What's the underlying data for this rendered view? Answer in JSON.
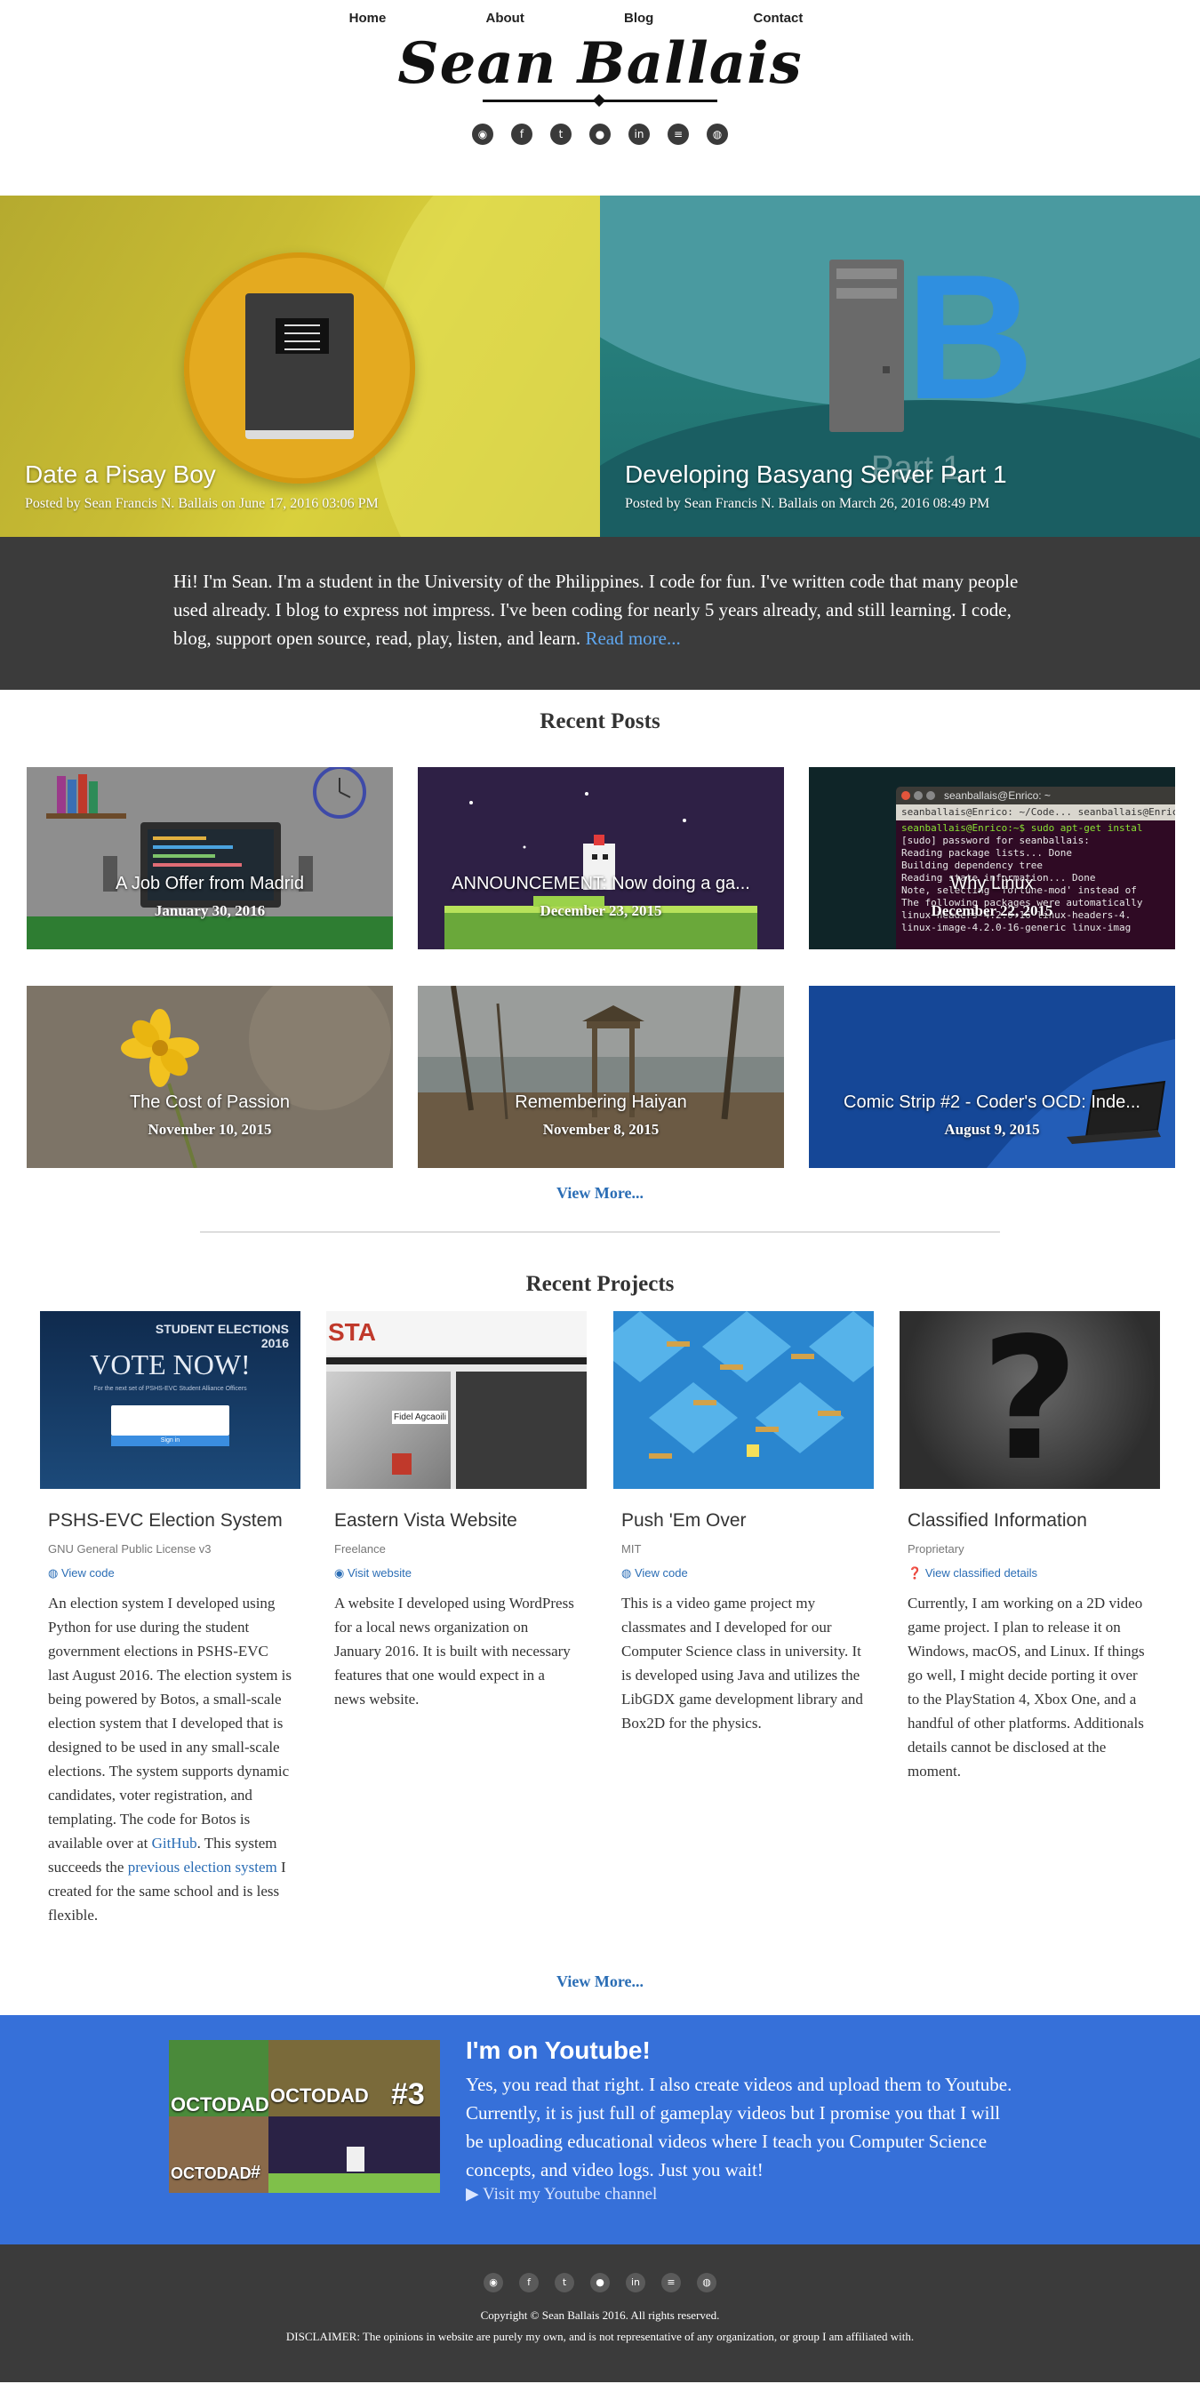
{
  "nav": {
    "items": [
      "Home",
      "About",
      "Blog",
      "Contact"
    ]
  },
  "logo": {
    "text": "Sean Ballais"
  },
  "socials": [
    "rss-icon",
    "facebook-icon",
    "twitter-icon",
    "reddit-icon",
    "linkedin-icon",
    "stackoverflow-icon",
    "github-icon"
  ],
  "hero": [
    {
      "title": "Date a Pisay Boy",
      "meta": "Posted by Sean Francis N. Ballais on June 17, 2016 03:06 PM"
    },
    {
      "title": "Developing Basyang Server Part 1",
      "meta": "Posted by Sean Francis N. Ballais on March 26, 2016 08:49 PM",
      "overlay": "Part 1"
    }
  ],
  "about": {
    "text": "Hi! I'm Sean. I'm a student in the University of the Philippines. I code for fun. I've written code that many people used already. I blog to express not impress. I've been coding for nearly 5 years already, and still learning. I code, blog, support open source, read, play, listen, and learn.",
    "link": "Read more..."
  },
  "recent_posts": {
    "heading": "Recent Posts",
    "items": [
      {
        "title": "A Job Offer from Madrid",
        "date": "January 30, 2016"
      },
      {
        "title": "ANNOUNCEMENT: Now doing a ga...",
        "date": "December 23, 2015"
      },
      {
        "title": "Why Linux",
        "date": "December 22, 2015"
      },
      {
        "title": "The Cost of Passion",
        "date": "November 10, 2015"
      },
      {
        "title": "Remembering Haiyan",
        "date": "November 8, 2015"
      },
      {
        "title": "Comic Strip #2 - Coder's OCD: Inde...",
        "date": "August 9, 2015"
      }
    ],
    "view_more": "View More..."
  },
  "terminal": {
    "window_title": "seanballais@Enrico: ~",
    "lines": [
      "seanballais@Enrico: ~/Code...  seanballais@Enrico",
      "seanballais@Enrico:~$ sudo apt-get instal",
      "[sudo] password for seanballais:",
      "Reading package lists... Done",
      "Building dependency tree",
      "Reading state information... Done",
      "Note, selecting 'fortune-mod' instead of",
      "The following packages were automatically",
      "  linux-headers-4.2.0-16 linux-headers-4.",
      "  linux-image-4.2.0-16-generic linux-imag"
    ]
  },
  "recent_projects": {
    "heading": "Recent Projects",
    "items": [
      {
        "title": "PSHS-EVC Election System",
        "license": "GNU General Public License v3",
        "link": "View code",
        "desc_before": "An election system I developed using Python for use during the student government elections in PSHS-EVC last August 2016. The election system is being powered by Botos, a small-scale election system that I developed that is designed to be used in any small-scale elections. The system supports dynamic candidates, voter registration, and templating. The code for Botos is available over at ",
        "desc_link1": "GitHub",
        "desc_mid": ". This system succeeds the ",
        "desc_link2": "previous election system",
        "desc_after": " I created for the same school and is less flexible.",
        "image_text": {
          "banner": "STUDENT ELECTIONS 2016",
          "vote": "VOTE NOW!",
          "sub": "For the next set of PSHS-EVC Student Alliance Officers",
          "button": "Sign in"
        }
      },
      {
        "title": "Eastern Vista Website",
        "license": "Freelance",
        "link": "Visit website",
        "desc": "A website I developed using WordPress for a local news organization on January 2016. It is built with necessary features that one would expect in a news website.",
        "image_text": {
          "brand": "STA",
          "headline": "Fidel Agcaoili"
        }
      },
      {
        "title": "Push 'Em Over",
        "license": "MIT",
        "link": "View code",
        "desc": "This is a video game project my classmates and I developed for our Computer Science class in university. It is developed using Java and utilizes the LibGDX game development library and Box2D for the physics."
      },
      {
        "title": "Classified Information",
        "license": "Proprietary",
        "link": "View classified details",
        "desc": "Currently, I am working on a 2D video game project. I plan to release it on Windows, macOS, and Linux. If things go well, I might decide porting it over to the PlayStation 4, Xbox One, and a handful of other platforms. Additionals details cannot be disclosed at the moment.",
        "image_text": {
          "glyph": "?"
        }
      }
    ],
    "view_more": "View More..."
  },
  "youtube": {
    "title": "I'm on Youtube!",
    "text": "Yes, you read that right. I also create videos and upload them to Youtube. Currently, it is just full of gameplay videos but I promise you that I will be uploading educational videos where I teach you Computer Science concepts, and video logs. Just you wait!",
    "link": "Visit my Youtube channel",
    "thumb_text": [
      "OCTODAD",
      "OCTODAD",
      "#3",
      "OCTODAD",
      "#"
    ]
  },
  "footer": {
    "copyright": "Copyright © Sean Ballais 2016. All rights reserved.",
    "disclaimer": "DISCLAIMER: The opinions in website are purely my own, and is not representative of any organization, or group I am affiliated with."
  },
  "colors": {
    "accent": "#2a6db5",
    "dark_band": "#3b3b3b",
    "youtube_band": "#3670d9"
  }
}
